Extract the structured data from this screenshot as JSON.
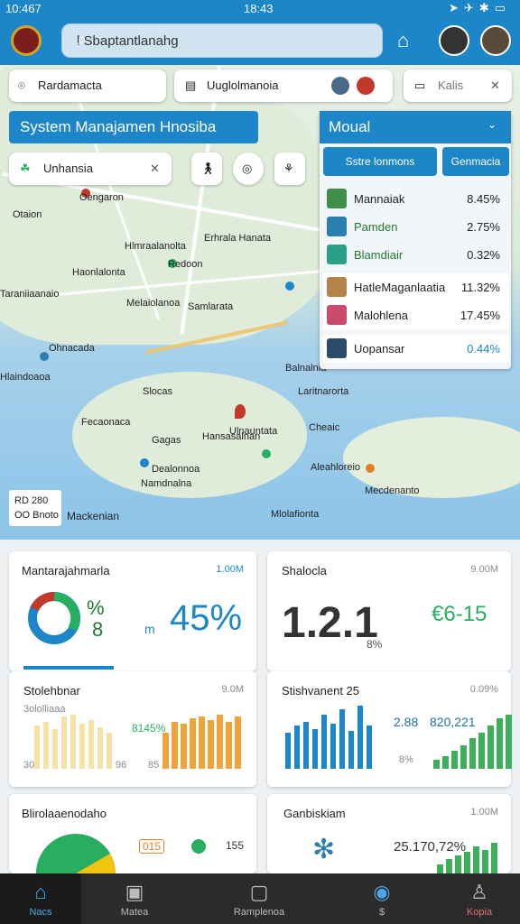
{
  "status": {
    "time_left": "10:467",
    "time_center": "18:43"
  },
  "search": {
    "text": "l Sbaptantlanahg"
  },
  "chips": {
    "location": "Rardamacta",
    "document": "Uuglolmanoia",
    "tools": "Kalis"
  },
  "title_bar": {
    "label": "System Manajamen Hnosiba"
  },
  "filter": {
    "label": "Unhansia"
  },
  "panel": {
    "title": "Moual",
    "btn1": "Sstre lonmons",
    "btn2": "Genmacia",
    "rows": [
      {
        "name": "Mannaiak",
        "pct": "8.45%"
      },
      {
        "name": "Pamden",
        "pct": "2.75%"
      },
      {
        "name": "Blamdiair",
        "pct": "0.32%"
      },
      {
        "name": "HatleMaganlaatia",
        "pct": "11.32%"
      },
      {
        "name": "Malohlena",
        "pct": "17.45%"
      },
      {
        "name": "Uopansar",
        "pct": "0.44%"
      }
    ]
  },
  "map_labels": [
    "Oengaron",
    "Otaion",
    "Hlmraalanolta",
    "Redoon",
    "Haonlalonta",
    "Taraniiaanaio",
    "Erhrala Hanata",
    "Slocas",
    "Samlarata",
    "Melaiolanoa",
    "Ohnacada",
    "Hlaindoaoa",
    "Ulnauntata",
    "Fecaonaca",
    "Aleahloreio",
    "Dealonnoa",
    "Namdnalna",
    "Mecdenanto",
    "Laritnarorta",
    "Balnalnia",
    "Cheaic",
    "Gagas",
    "Mlolafionta",
    "Hansasalnan"
  ],
  "map_legend": {
    "l1": "RD 280",
    "l2": "OO Bnoto",
    "l3": "Mackenian"
  },
  "cards": [
    {
      "title": "Mantarajahmarla",
      "val": "1.00M",
      "pct": "%",
      "sub": "8",
      "big": "45%",
      "prefix": "m"
    },
    {
      "title": "Shalocla",
      "val": "9.00M",
      "big": "1.2.1",
      "sub": "8%",
      "right": "€6-15"
    },
    {
      "title": "Stolehbnar",
      "val": "9.0M",
      "left": "3ololliaaa",
      "mid": "8145%",
      "l1": "30",
      "l2": "96",
      "l3": "85"
    },
    {
      "title": "Stishvanent 25",
      "val": "0.09%",
      "r1": "2.88",
      "r2": "820,221",
      "r3": "8%"
    },
    {
      "title": "Blirolaaenodaho",
      "v1": "015",
      "v2": "155"
    },
    {
      "title": "Ganbiskiam",
      "val": "1.00M",
      "big": "25.170,72%"
    }
  ],
  "nav": [
    {
      "label": "Nacs",
      "icon": "home-icon"
    },
    {
      "label": "Matea",
      "icon": "box-icon"
    },
    {
      "label": "Ramplenoa",
      "icon": "folder-icon"
    },
    {
      "label": "$",
      "icon": "compass-icon"
    },
    {
      "label": "Kopia",
      "icon": "user-icon"
    }
  ]
}
